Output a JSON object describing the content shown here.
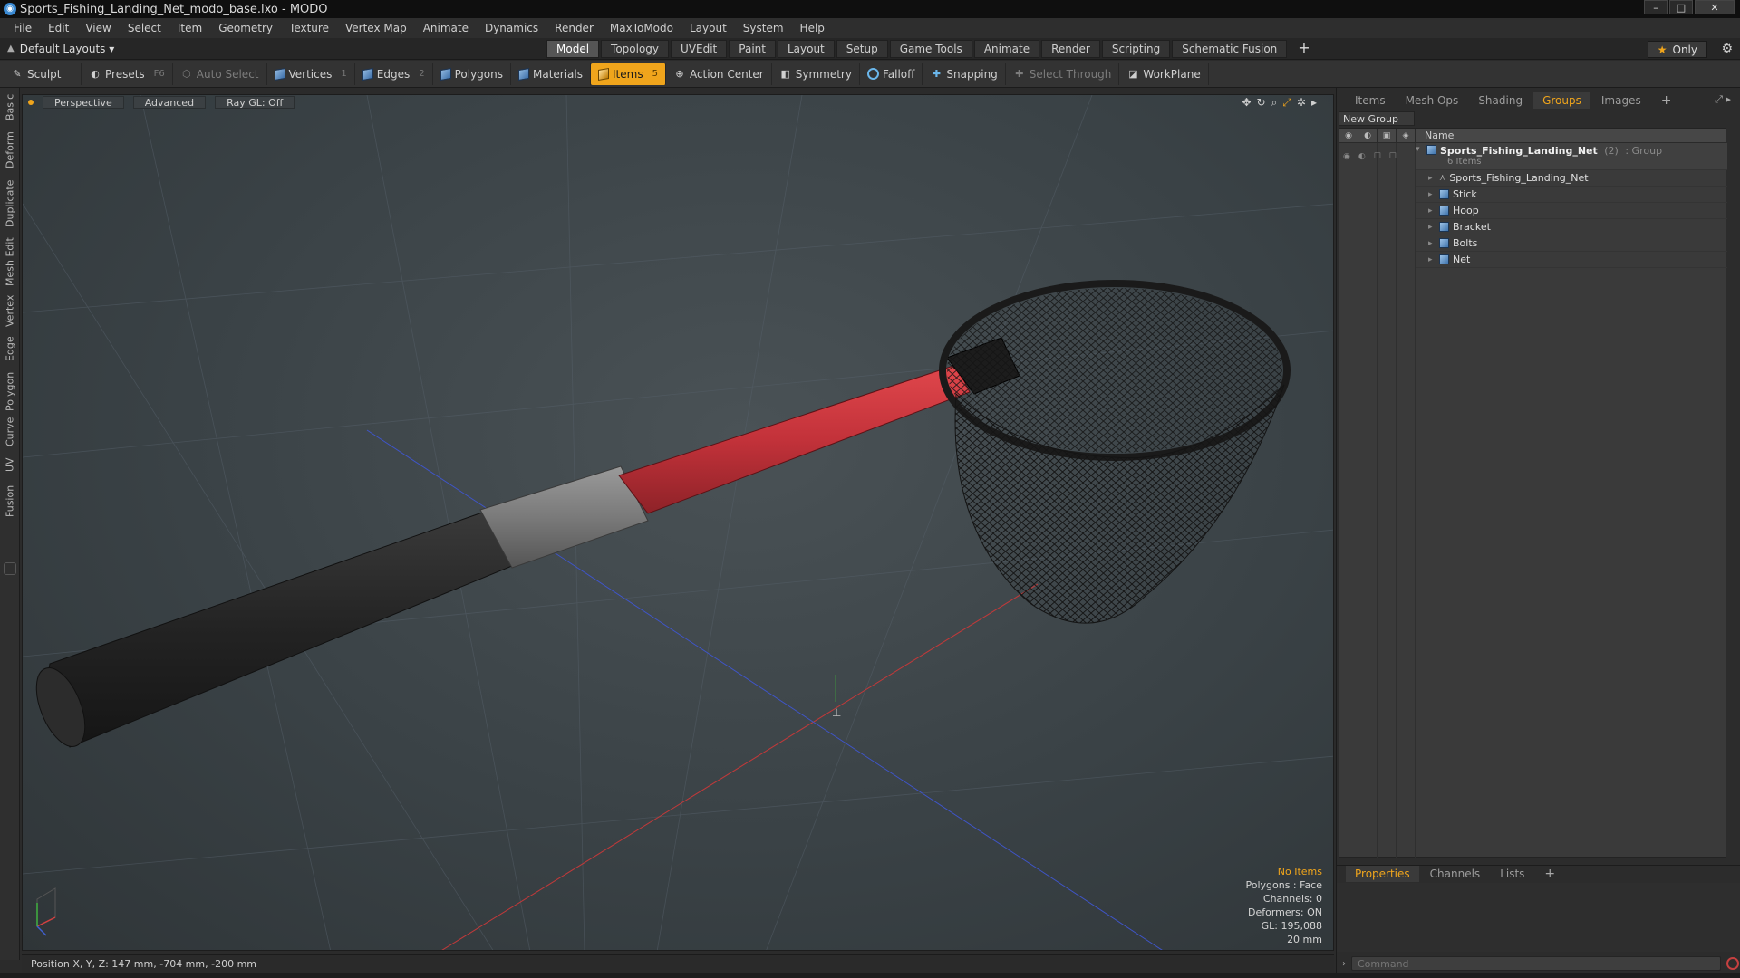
{
  "window": {
    "title": "Sports_Fishing_Landing_Net_modo_base.lxo - MODO",
    "controls": [
      "–",
      "□",
      "✕"
    ]
  },
  "menu": [
    "File",
    "Edit",
    "View",
    "Select",
    "Item",
    "Geometry",
    "Texture",
    "Vertex Map",
    "Animate",
    "Dynamics",
    "Render",
    "MaxToModo",
    "Layout",
    "System",
    "Help"
  ],
  "layout_bar": {
    "layout_name": "Default Layouts ▾",
    "tabs": [
      "Model",
      "Topology",
      "UVEdit",
      "Paint",
      "Layout",
      "Setup",
      "Game Tools",
      "Animate",
      "Render",
      "Scripting",
      "Schematic Fusion"
    ],
    "active_tab": "Model",
    "plus": "+",
    "only_label": "Only"
  },
  "toolbar": {
    "sculpt": "Sculpt",
    "presets": "Presets",
    "presets_key": "F6",
    "auto_select": "Auto Select",
    "vertices": "Vertices",
    "vertices_key": "1",
    "edges": "Edges",
    "edges_key": "2",
    "polygons": "Polygons",
    "materials": "Materials",
    "items": "Items",
    "items_key": "5",
    "action_center": "Action Center",
    "symmetry": "Symmetry",
    "falloff": "Falloff",
    "snapping": "Snapping",
    "select_through": "Select Through",
    "workplane": "WorkPlane"
  },
  "left_tabs": [
    "Basic",
    "Deform",
    "Duplicate",
    "Mesh Edit",
    "Vertex",
    "Edge",
    "Polygon",
    "Curve",
    "UV",
    "Fusion"
  ],
  "viewport": {
    "view_mode": "Perspective",
    "shading": "Advanced",
    "raygl": "Ray GL: Off",
    "info": {
      "selection": "No Items",
      "polygons": "Polygons : Face",
      "channels": "Channels: 0",
      "deformers": "Deformers: ON",
      "gl": "GL: 195,088",
      "scale": "20 mm"
    }
  },
  "status": {
    "position": "Position X, Y, Z:  147 mm, -704 mm, -200 mm"
  },
  "right_panel": {
    "tabs": [
      "Items",
      "Mesh Ops",
      "Shading",
      "Groups",
      "Images"
    ],
    "active_tab": "Groups",
    "plus": "+",
    "new_group": "New Group",
    "column_name": "Name",
    "group": {
      "name": "Sports_Fishing_Landing_Net",
      "count": "(2)",
      "type": ": Group",
      "items_count": "6 Items"
    },
    "children": [
      "Sports_Fishing_Landing_Net",
      "Stick",
      "Hoop",
      "Bracket",
      "Bolts",
      "Net"
    ],
    "bottom_tabs": [
      "Properties",
      "Channels",
      "Lists"
    ],
    "bottom_active": "Properties",
    "command_placeholder": "Command"
  },
  "colors": {
    "accent": "#f0a51c",
    "viewport_bg": "#3a4246",
    "handle_red": "#c9343a",
    "grip_black": "#252525",
    "collar_gray": "#7a7a7a"
  }
}
